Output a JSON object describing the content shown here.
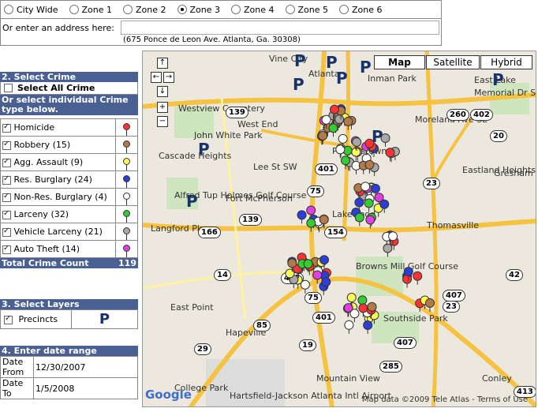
{
  "zones": [
    {
      "label": "City Wide",
      "selected": false
    },
    {
      "label": "Zone 1",
      "selected": false
    },
    {
      "label": "Zone 2",
      "selected": false
    },
    {
      "label": "Zone 3",
      "selected": true
    },
    {
      "label": "Zone 4",
      "selected": false
    },
    {
      "label": "Zone 5",
      "selected": false
    },
    {
      "label": "Zone 6",
      "selected": false
    }
  ],
  "address": {
    "label": "Or enter an address here:",
    "value": "",
    "hint": "(675 Ponce de Leon Ave. Atlanta, Ga. 30308)"
  },
  "crime_section": {
    "title": "2. Select Crime",
    "select_all": "Select All Crime",
    "subtitle": "Or select individual Crime type below.",
    "items": [
      {
        "label": "Homicide",
        "color": "#ff3333"
      },
      {
        "label": "Robbery (15)",
        "color": "#b07a4a"
      },
      {
        "label": "Agg. Assault (9)",
        "color": "#ffff55"
      },
      {
        "label": "Res. Burglary (24)",
        "color": "#2b3fd8"
      },
      {
        "label": "Non-Res. Burglary (4)",
        "color": "#ffffff"
      },
      {
        "label": "Larceny (32)",
        "color": "#33cc33"
      },
      {
        "label": "Vehicle Larceny (21)",
        "color": "#a8a8a8"
      },
      {
        "label": "Auto Theft (14)",
        "color": "#e040e0"
      }
    ],
    "total_label": "Total Crime Count",
    "total_value": "119"
  },
  "layers": {
    "title": "3. Select Layers",
    "precincts_label": "Precincts",
    "precinct_icon": "P"
  },
  "dates": {
    "title": "4. Enter date range",
    "from_label": "Date From",
    "from_value": "12/30/2007",
    "to_label": "Date To",
    "to_value": "1/5/2008"
  },
  "map": {
    "types": [
      "Map",
      "Satellite",
      "Hybrid"
    ],
    "selected_type": "Map",
    "attribution": "Map data ©2009 Tele Atlas - Terms of Use",
    "logo": "Google",
    "labels": [
      "Vine City",
      "Atlanta",
      "Inman Park",
      "East Lake",
      "Memorial Dr SE",
      "Westview Cemetery",
      "West End",
      "John White Park",
      "Peoplestown",
      "Cascade Heights",
      "Fort McPherson",
      "Alfred Tup Holmes Golf Course",
      "Lakewood",
      "Eastland Heights",
      "Gresham Park",
      "Thomasville",
      "Browns Mill Golf Course",
      "East Point",
      "Hapeville",
      "Southside Park",
      "Mountain View",
      "Conley",
      "College Park",
      "Hartsfield-Jackson Atlanta Intl Airport",
      "Langford Pkwy",
      "Moreland Ave SE",
      "Lee St SW"
    ],
    "shields": [
      "139",
      "260",
      "402",
      "20",
      "401",
      "75",
      "139",
      "166",
      "154",
      "14",
      "403",
      "85",
      "29",
      "19",
      "407",
      "75",
      "401",
      "407",
      "285",
      "413",
      "23",
      "23",
      "42"
    ]
  }
}
